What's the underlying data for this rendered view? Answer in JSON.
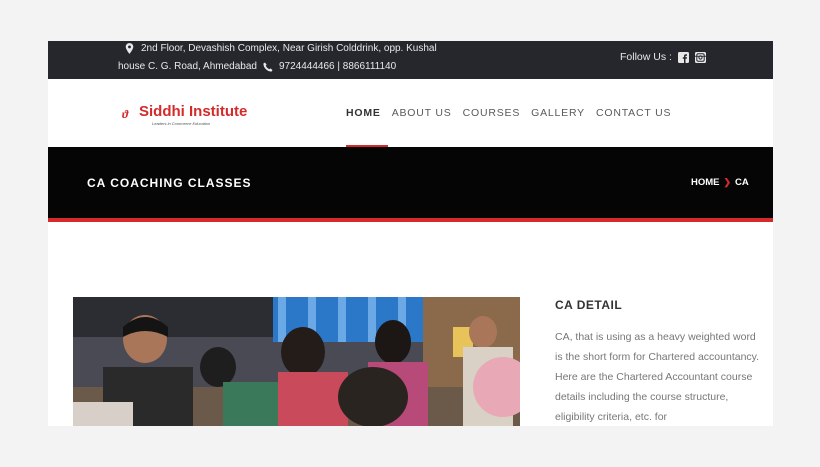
{
  "topbar": {
    "address_line1": "2nd Floor, Devashish Complex, Near Girish Colddrink, opp. Kushal",
    "address_line2": "house C. G. Road, Ahmedabad",
    "phones": "9724444466 | 8866111140",
    "follow_label": "Follow Us :",
    "icons": [
      "map-pin-icon",
      "phone-icon",
      "facebook-icon",
      "instagram-icon"
    ]
  },
  "brand": {
    "name": "Siddhi Institute",
    "tagline": "Leaders in Commerce Education"
  },
  "nav": {
    "items": [
      "HOME",
      "ABOUT US",
      "COURSES",
      "GALLERY",
      "CONTACT US"
    ],
    "active": "HOME"
  },
  "banner": {
    "title": "CA COACHING CLASSES",
    "breadcrumb": [
      "HOME",
      "CA"
    ]
  },
  "detail": {
    "title": "CA DETAIL",
    "text": "CA, that is using as a heavy weighted word is the short form for Chartered accountancy. Here are the Chartered Accountant course details including the course structure, eligibility criteria, etc. for"
  },
  "colors": {
    "accent": "#d42a2a",
    "topbar_bg": "#25272d",
    "banner_bg": "#050505"
  }
}
